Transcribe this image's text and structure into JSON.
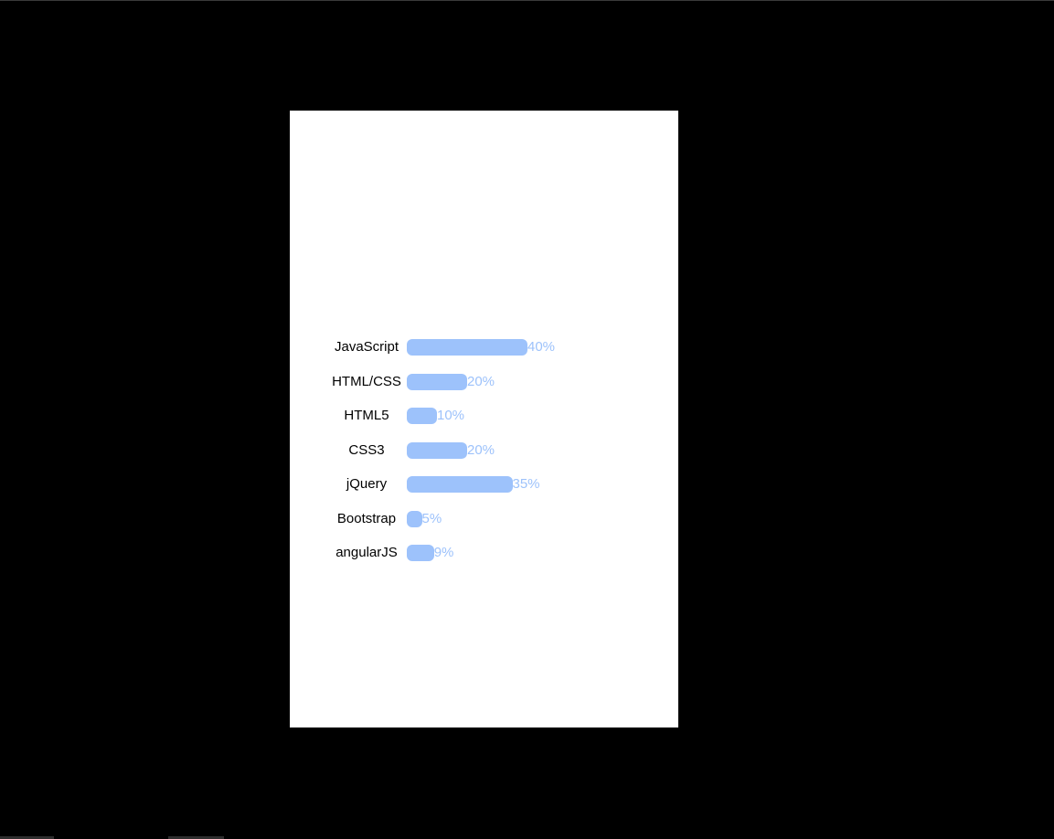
{
  "colors": {
    "background": "#000000",
    "panel": "#ffffff",
    "bar": "#9dc2fb",
    "percent_text": "#9dc2fb",
    "label_text": "#000000"
  },
  "chart_data": {
    "type": "bar",
    "orientation": "horizontal",
    "categories": [
      "JavaScript",
      "HTML/CSS",
      "HTML5",
      "CSS3",
      "jQuery",
      "Bootstrap",
      "angularJS"
    ],
    "values": [
      40,
      20,
      10,
      20,
      35,
      5,
      9
    ],
    "value_labels": [
      "40%",
      "20%",
      "10%",
      "20%",
      "35%",
      "5%",
      "9%"
    ],
    "title": "",
    "xlabel": "",
    "ylabel": "",
    "xlim": [
      0,
      100
    ],
    "grid": false
  }
}
